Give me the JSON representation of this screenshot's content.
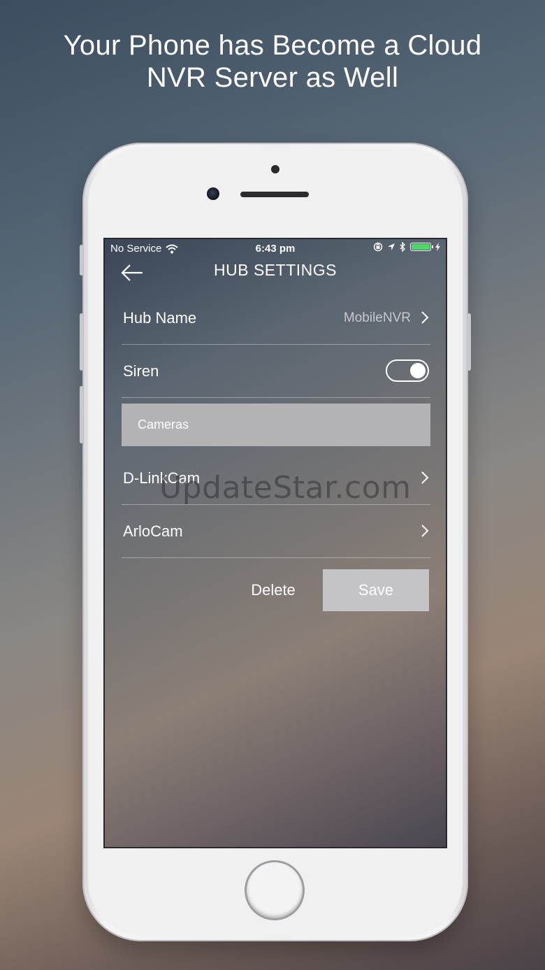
{
  "headline": {
    "line1": "Your Phone has Become a Cloud",
    "line2": "NVR Server as Well"
  },
  "status_bar": {
    "carrier": "No Service",
    "time": "6:43 pm",
    "icons": [
      "wifi-icon",
      "orientation-lock-icon",
      "location-icon",
      "bluetooth-icon",
      "battery-icon",
      "charging-icon"
    ],
    "battery_color": "#4cd964"
  },
  "nav": {
    "title": "HUB SETTINGS",
    "back_icon": "back-arrow-icon"
  },
  "settings": {
    "hub_name_label": "Hub Name",
    "hub_name_value": "MobileNVR",
    "siren_label": "Siren",
    "siren_on": true,
    "cameras_header": "Cameras",
    "cameras": [
      {
        "name": "D-LinkCam"
      },
      {
        "name": "ArloCam"
      }
    ]
  },
  "actions": {
    "delete_label": "Delete",
    "save_label": "Save"
  },
  "watermark": "UpdateStar.com"
}
